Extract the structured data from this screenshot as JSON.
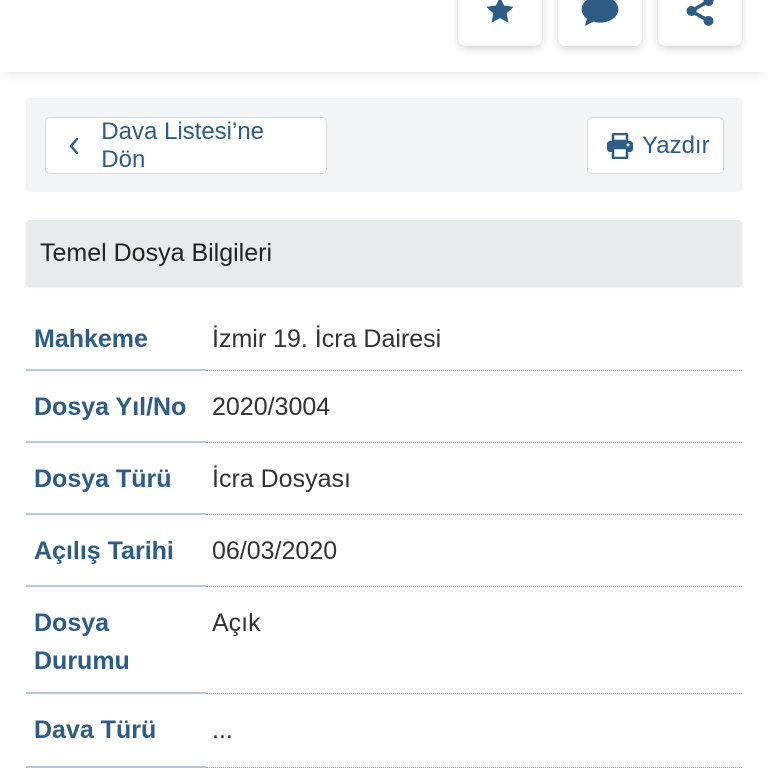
{
  "top_actions": [
    {
      "icon": "star-icon",
      "label": ""
    },
    {
      "icon": "comment-icon",
      "label": ""
    },
    {
      "icon": "share-icon",
      "label": ""
    }
  ],
  "nav": {
    "back_label": "Dava Listesi’ne Dön",
    "print_label": "Yazdır"
  },
  "section": {
    "title": "Temel Dosya Bilgileri"
  },
  "details": [
    {
      "key": "Mahkeme",
      "value": "İzmir 19. İcra Dairesi"
    },
    {
      "key": "Dosya Yıl/No",
      "value": "2020/3004"
    },
    {
      "key": "Dosya Türü",
      "value": "İcra Dosyası"
    },
    {
      "key": "Açılış Tarihi",
      "value": "06/03/2020"
    },
    {
      "key": "Dosya\nDurumu",
      "value": "Açık"
    },
    {
      "key": "Dava Türü",
      "value": "..."
    }
  ],
  "colors": {
    "accent": "#2e5c85",
    "panel_bg": "#f3f4f5",
    "header_bg": "#e8eaec"
  }
}
